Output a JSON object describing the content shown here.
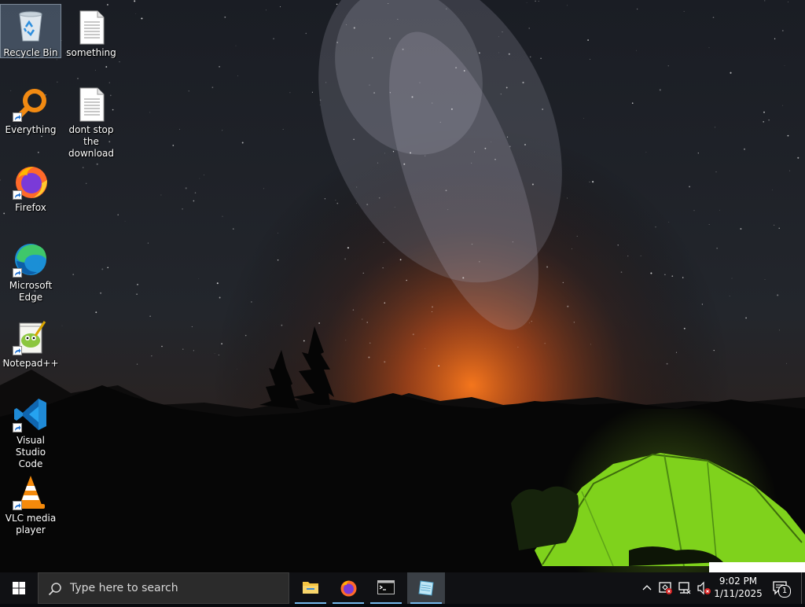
{
  "desktop": {
    "icons": [
      {
        "label": "Recycle Bin",
        "icon": "recycle-bin-icon",
        "selected": true
      },
      {
        "label": "something",
        "icon": "text-file-icon"
      },
      {
        "label": "Everything",
        "icon": "everything-search-icon"
      },
      {
        "label": "dont stop the download",
        "icon": "text-file-icon"
      },
      {
        "label": "Firefox",
        "icon": "firefox-icon"
      },
      {
        "label": "Microsoft Edge",
        "icon": "edge-icon"
      },
      {
        "label": "Notepad++",
        "icon": "notepad-plus-plus-icon"
      },
      {
        "label": "Visual Studio Code",
        "icon": "vscode-icon"
      },
      {
        "label": "VLC media player",
        "icon": "vlc-icon"
      }
    ]
  },
  "taskbar": {
    "search_placeholder": "Type here to search",
    "pinned_apps": [
      {
        "name": "File Explorer",
        "icon": "folder-icon"
      },
      {
        "name": "Firefox",
        "icon": "firefox-icon"
      },
      {
        "name": "Command Prompt",
        "icon": "terminal-icon"
      },
      {
        "name": "Notepad",
        "icon": "notepad-icon",
        "active": true
      }
    ],
    "clock": {
      "time": "9:02 PM",
      "date": "1/11/2025"
    },
    "notification_count": "1"
  },
  "colors": {
    "taskbar_bg": "#101114",
    "accent": "#76b9ed",
    "tent_green": "#7fd21c",
    "horizon_glow": "#e0661b"
  }
}
